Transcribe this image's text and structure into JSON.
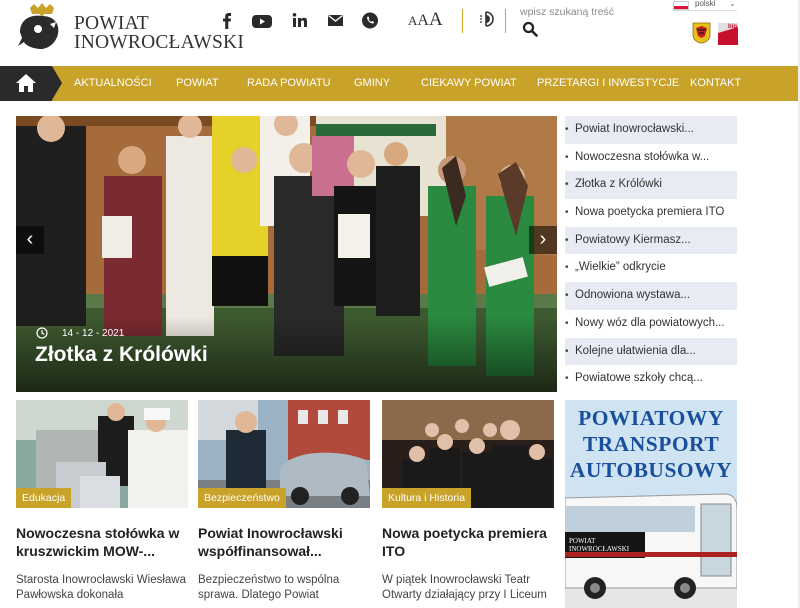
{
  "header": {
    "logo_line1": "POWIAT",
    "logo_line2": "INOWROCŁAWSKI",
    "font_size_labels": [
      "A",
      "A",
      "A"
    ],
    "search_placeholder": "wpisz szukaną treść",
    "language": "polski",
    "bip_label": "bip",
    "social_icons": [
      "facebook-icon",
      "youtube-icon",
      "linkedin-icon",
      "mail-icon",
      "phone-icon"
    ]
  },
  "nav": {
    "items": [
      "AKTUALNOŚCI",
      "POWIAT",
      "RADA POWIATU",
      "GMINY",
      "CIEKAWY POWIAT",
      "PRZETARGI I INWESTYCJE",
      "KONTAKT"
    ]
  },
  "slider": {
    "date": "14 - 12 - 2021",
    "title": "Złotka z Królówki"
  },
  "side_news": [
    "Powiat Inowrocławski...",
    "Nowoczesna stołówka w...",
    "Złotka z Królówki",
    "Nowa poetycka premiera ITO",
    "Powiatowy Kiermasz...",
    "„Wielkie” odkrycie",
    "Odnowiona wystawa...",
    "Nowy wóz dla powiatowych...",
    "Kolejne ułatwienia dla...",
    "Powiatowe szkoły chcą..."
  ],
  "cards": [
    {
      "category": "Edukacja",
      "title": "Nowoczesna stołówka w kruszwickim MOW-...",
      "text": "Starosta Inowrocławski Wiesława Pawłowska dokonała"
    },
    {
      "category": "Bezpieczeństwo",
      "title": "Powiat Inowrocławski współfinansował...",
      "text": "Bezpieczeństwo to wspólna sprawa. Dlatego Powiat"
    },
    {
      "category": "Kultura i Historia",
      "title": "Nowa poetycka premiera ITO",
      "text": "W piątek Inowrocławski Teatr Otwarty działający przy I Liceum"
    }
  ],
  "banner": {
    "line1": "POWIATOWY",
    "line2": "TRANSPORT",
    "line3": "AUTOBUSOWY",
    "bus_label": "POWIAT INOWROCŁAWSKI"
  },
  "colors": {
    "accent": "#c9a22a",
    "nav_home": "#2a2a2a",
    "side_stripe": "#e8ebf4",
    "banner_text": "#1a4f9c"
  }
}
